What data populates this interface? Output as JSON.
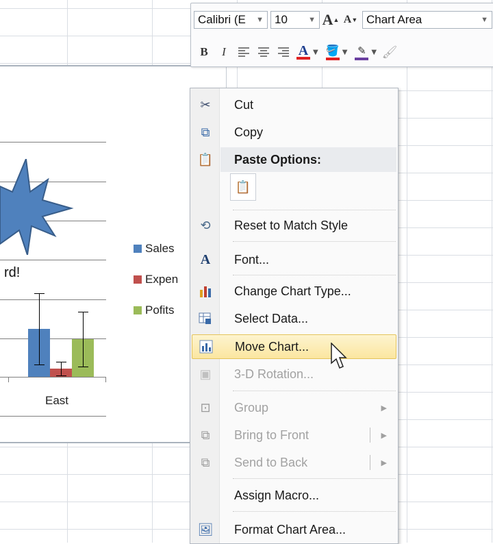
{
  "toolbar": {
    "font_name": "Calibri (E",
    "font_size": "10",
    "grow_font": "A",
    "shrink_font": "A",
    "chart_element": "Chart Area",
    "bold": "B",
    "italic": "I",
    "font_color_glyph": "A"
  },
  "chart": {
    "category": "East",
    "shape_text": "rd!",
    "legend": [
      {
        "label": "Sales",
        "color": "#4f81bd"
      },
      {
        "label": "Expen",
        "color": "#c0504d"
      },
      {
        "label": "Pofits",
        "color": "#9bbb59"
      }
    ]
  },
  "chart_data": {
    "type": "bar",
    "categories": [
      "East"
    ],
    "series": [
      {
        "name": "Sales",
        "values": [
          70
        ]
      },
      {
        "name": "Expen",
        "values": [
          12
        ]
      },
      {
        "name": "Pofits",
        "values": [
          55
        ]
      }
    ],
    "error_bars": true
  },
  "context_menu": {
    "items": [
      {
        "label": "Cut",
        "icon": "scissors-icon"
      },
      {
        "label": "Copy",
        "icon": "copy-icon"
      },
      {
        "label": "Paste Options:",
        "icon": "paste-icon"
      },
      {
        "label": "Reset to Match Style",
        "icon": "reset-style-icon"
      },
      {
        "label": "Font...",
        "icon": "font-icon"
      },
      {
        "label": "Change Chart Type...",
        "icon": "chart-type-icon"
      },
      {
        "label": "Select Data...",
        "icon": "select-data-icon"
      },
      {
        "label": "Move Chart...",
        "icon": "move-chart-icon"
      },
      {
        "label": "3-D Rotation...",
        "icon": "rotation-3d-icon"
      },
      {
        "label": "Group",
        "icon": "group-icon"
      },
      {
        "label": "Bring to Front",
        "icon": "bring-front-icon"
      },
      {
        "label": "Send to Back",
        "icon": "send-back-icon"
      },
      {
        "label": "Assign Macro...",
        "icon": ""
      },
      {
        "label": "Format Chart Area...",
        "icon": "format-chart-area-icon"
      }
    ]
  },
  "colors": {
    "sales": "#4f81bd",
    "expenses": "#c0504d",
    "profits": "#9bbb59",
    "shape": "#4f81bd",
    "hover": "#fbe6a0"
  }
}
